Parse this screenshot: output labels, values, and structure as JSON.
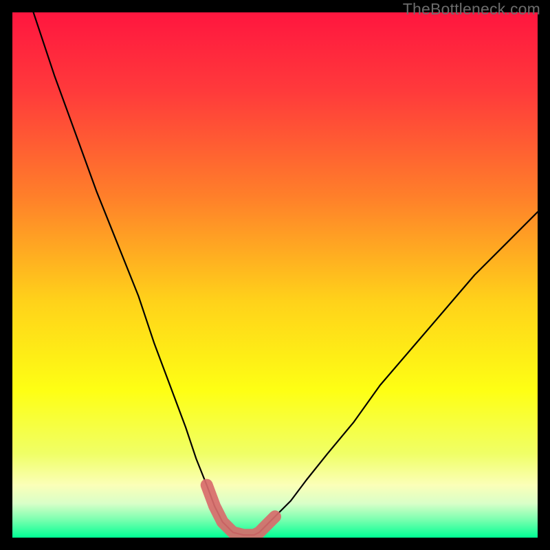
{
  "watermark": "TheBottleneck.com",
  "chart_data": {
    "type": "line",
    "title": "",
    "xlabel": "",
    "ylabel": "",
    "xlim": [
      0,
      100
    ],
    "ylim": [
      0,
      100
    ],
    "series": [
      {
        "name": "bottleneck-curve",
        "x": [
          4,
          8,
          12,
          16,
          20,
          24,
          27,
          30,
          33,
          35,
          37,
          38.5,
          40,
          42,
          44,
          46,
          47,
          48,
          50,
          53,
          56,
          60,
          65,
          70,
          76,
          82,
          88,
          94,
          100
        ],
        "y": [
          100,
          88,
          77,
          66,
          56,
          46,
          37,
          29,
          21,
          15,
          10,
          6,
          3,
          1,
          0.5,
          0.5,
          1,
          2,
          4,
          7,
          11,
          16,
          22,
          29,
          36,
          43,
          50,
          56,
          62
        ]
      }
    ],
    "highlight": {
      "name": "bottleneck-valley",
      "x": [
        37,
        38.5,
        40,
        42,
        44,
        46,
        47,
        48,
        50
      ],
      "y": [
        10,
        6,
        3,
        1,
        0.5,
        0.5,
        1,
        2,
        4
      ]
    },
    "gradient_stops": [
      {
        "offset": 0.0,
        "color": "#ff163f"
      },
      {
        "offset": 0.15,
        "color": "#ff3a3b"
      },
      {
        "offset": 0.35,
        "color": "#ff7f2a"
      },
      {
        "offset": 0.55,
        "color": "#ffd21a"
      },
      {
        "offset": 0.72,
        "color": "#feff14"
      },
      {
        "offset": 0.84,
        "color": "#f0ff66"
      },
      {
        "offset": 0.9,
        "color": "#fbffb8"
      },
      {
        "offset": 0.935,
        "color": "#d9ffc8"
      },
      {
        "offset": 0.965,
        "color": "#7dffb0"
      },
      {
        "offset": 1.0,
        "color": "#00ff94"
      }
    ]
  }
}
